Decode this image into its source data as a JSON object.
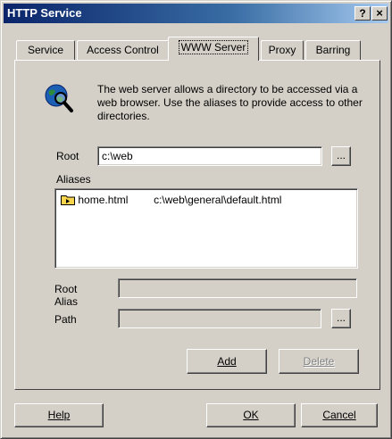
{
  "window": {
    "title": "HTTP Service",
    "help_glyph": "?",
    "close_glyph": "×"
  },
  "tabs": [
    {
      "label": "Service",
      "active": false
    },
    {
      "label": "Access Control",
      "active": false
    },
    {
      "label": "WWW Server",
      "active": true
    },
    {
      "label": "Proxy",
      "active": false
    },
    {
      "label": "Barring",
      "active": false
    }
  ],
  "panel": {
    "icon": "globe-search-icon",
    "description": "The web server allows a directory to be accessed via a web browser.  Use the aliases to provide access to other directories.",
    "root_label": "Root",
    "root_value": "c:\\web",
    "browse_label": "...",
    "aliases_label": "Aliases",
    "aliases": [
      {
        "icon": "folder-icon",
        "name": "home.html",
        "path": "c:\\web\\general\\default.html"
      }
    ],
    "root_alias_label": "Root Alias",
    "root_alias_value": "",
    "path_label": "Path",
    "path_value": "",
    "add_label": "Add",
    "delete_label": "Delete"
  },
  "footer": {
    "help_label": "Help",
    "ok_label": "OK",
    "cancel_label": "Cancel"
  },
  "colors": {
    "face": "#d4d0c8",
    "title_start": "#0a246a",
    "title_end": "#a6caf0"
  }
}
